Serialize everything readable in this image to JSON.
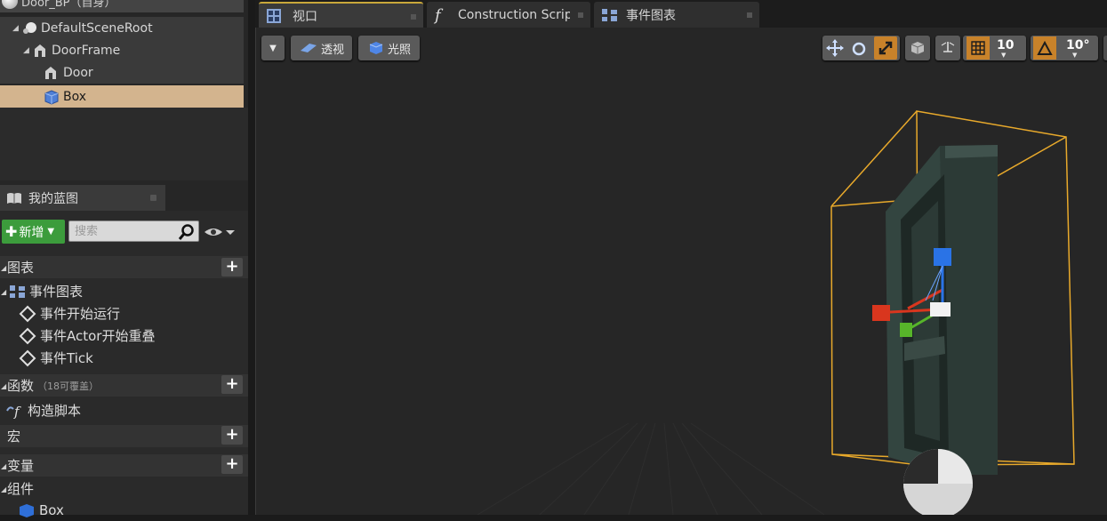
{
  "components_panel": {
    "title": "Door_BP（自身）",
    "tree": [
      {
        "label": "DefaultSceneRoot",
        "icon": "scene-root-icon"
      },
      {
        "label": "DoorFrame",
        "icon": "static-mesh-icon"
      },
      {
        "label": "Door",
        "icon": "static-mesh-icon"
      },
      {
        "label": "Box",
        "icon": "box-collision-icon",
        "selected": true
      }
    ]
  },
  "my_blueprint": {
    "tab_label": "我的蓝图",
    "add_button": "新增",
    "search_placeholder": "搜索",
    "sections": {
      "graphs": "图表",
      "event_graph": "事件图表",
      "events": [
        "事件开始运行",
        "事件Actor开始重叠",
        "事件Tick"
      ],
      "functions": "函数",
      "functions_note": "（18可覆盖）",
      "construction_script": "构造脚本",
      "macros": "宏",
      "variables": "变量",
      "components": "组件",
      "components_items": [
        "Box"
      ]
    }
  },
  "tabs": [
    {
      "label": "视口",
      "icon": "viewport-icon",
      "active": true
    },
    {
      "label": "Construction Script",
      "icon": "function-icon",
      "active": false
    },
    {
      "label": "事件图表",
      "icon": "event-graph-icon",
      "active": false
    }
  ],
  "viewport_toolbar": {
    "perspective": "透视",
    "lighting": "光照",
    "grid_snap": "10",
    "rotation_snap": "10°"
  },
  "colors": {
    "selection": "#d3b48e",
    "add_button": "#3c9c3c",
    "active_tab_accent": "#c9a83a",
    "snap_active": "#c8822a",
    "bounds": "#e8a92b"
  }
}
